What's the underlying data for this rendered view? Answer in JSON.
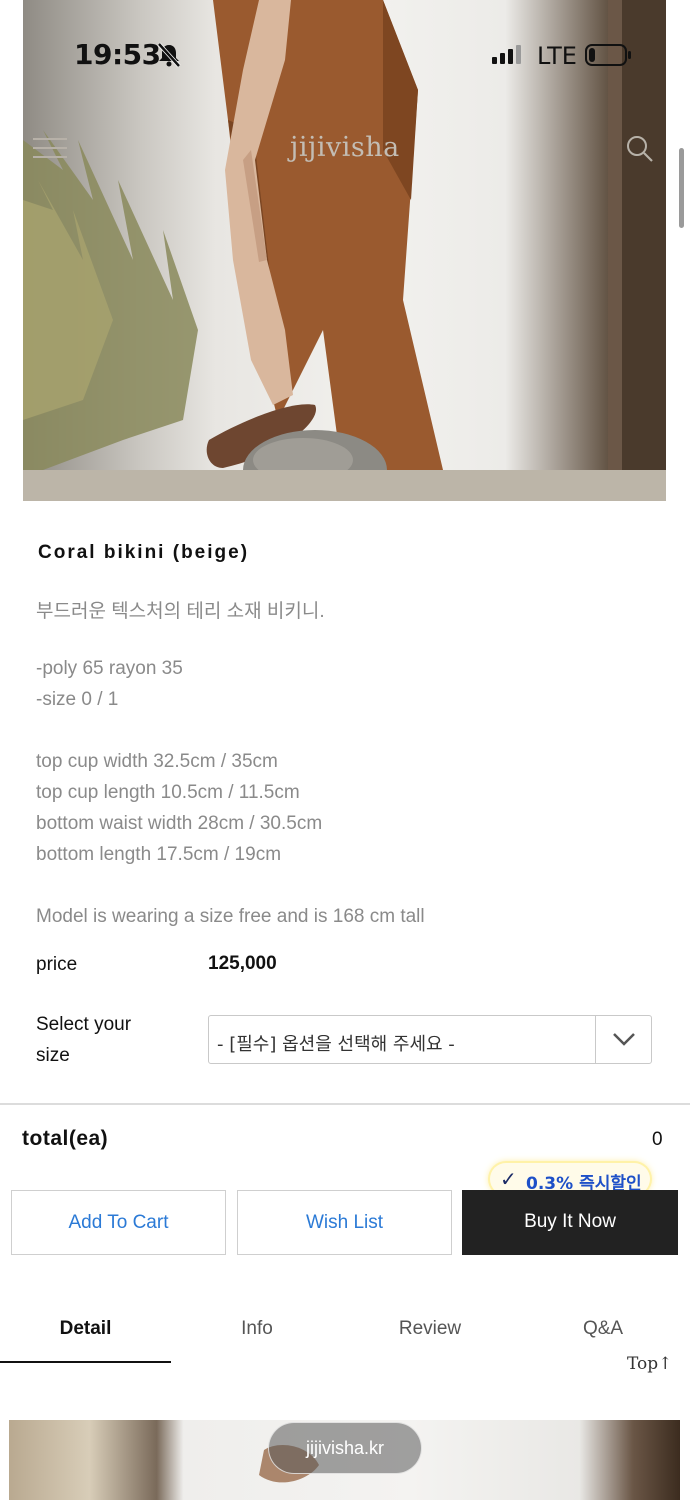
{
  "status_bar": {
    "time": "19:53",
    "network": "LTE"
  },
  "header": {
    "brand": "jijivisha"
  },
  "product": {
    "title": "Coral bikini (beige)",
    "description_ko": "부드러운 텍스처의 테리 소재 비키니.",
    "material": "-poly 65 rayon 35",
    "sizes": "-size 0 / 1",
    "measurements": [
      "top cup width 32.5cm / 35cm",
      "top cup length 10.5cm / 11.5cm",
      "bottom waist width 28cm / 30.5cm",
      "bottom length 17.5cm / 19cm"
    ],
    "model_note": "Model is wearing a size free and is 168 cm tall",
    "price_label": "price",
    "price_value": "125,000",
    "size_label_line1": "Select your",
    "size_label_line2": "size",
    "size_select_value": "- [필수] 옵션을 선택해 주세요 -"
  },
  "order": {
    "total_label": "total(ea)",
    "total_value": "0",
    "discount_badge": "0.3% 즉시할인",
    "add_to_cart": "Add To Cart",
    "wish_list": "Wish List",
    "buy_now": "Buy It Now"
  },
  "tabs": [
    "Detail",
    "Info",
    "Review",
    "Q&A"
  ],
  "top_link": "Top↑",
  "footer_pill": "jijivisha.kr",
  "colors": {
    "accent_blue": "#2b7ad6",
    "dark_button": "#222222",
    "badge_text": "#1e50c8"
  }
}
